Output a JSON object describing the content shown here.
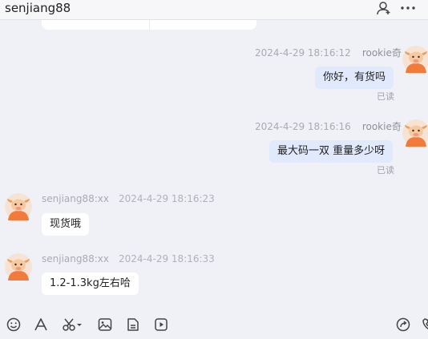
{
  "header": {
    "title": "senjiang88"
  },
  "messages": [
    {
      "side": "right",
      "sender": "rookie奇",
      "time": "2024-4-29 18:16:12",
      "text": "你好，有货吗",
      "status": "已读"
    },
    {
      "side": "right",
      "sender": "rookie奇",
      "time": "2024-4-29 18:16:16",
      "text": "最大码一双 重量多少呀",
      "status": "已读"
    },
    {
      "side": "left",
      "sender": "senjiang88:xx",
      "time": "2024-4-29 18:16:23",
      "text": "现货哦"
    },
    {
      "side": "left",
      "sender": "senjiang88:xx",
      "time": "2024-4-29 18:16:33",
      "text": "1.2-1.3kg左右哈"
    }
  ],
  "colors": {
    "my_bubble": "#e1e9fc",
    "their_bubble": "#ffffff",
    "background": "#f0f1f6",
    "avatar": "#f27a3a"
  },
  "toolbar": [
    "emoji-icon",
    "font-icon",
    "scissors-icon",
    "image-icon",
    "file-icon",
    "video-icon",
    "share-icon",
    "phone-icon"
  ]
}
